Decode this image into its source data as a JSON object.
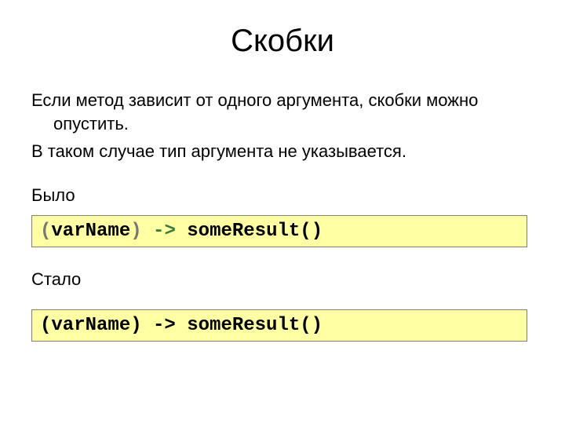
{
  "title": "Скобки",
  "para1": "Если метод зависит от одного аргумента, скобки можно опустить.",
  "para2": "В таком случае тип аргумента не указывается.",
  "label_before": "Было",
  "label_after": "Стало",
  "code1": {
    "open_paren": "(",
    "varname": "varName",
    "close_paren": ")",
    "space1": " ",
    "arrow": "->",
    "space2": " ",
    "call": "someResult()"
  },
  "code2": {
    "full": "(varName) -> someResult()"
  }
}
